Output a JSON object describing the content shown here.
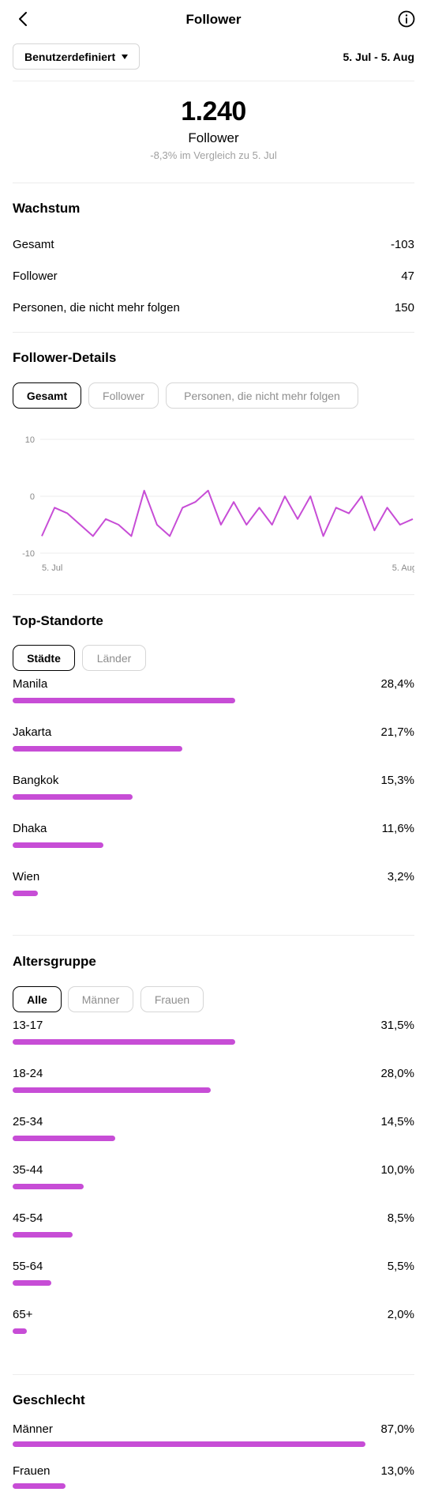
{
  "header": {
    "title": "Follower"
  },
  "range": {
    "dropdown_label": "Benutzerdefiniert",
    "date_range": "5. Jul - 5. Aug"
  },
  "summary": {
    "value": "1.240",
    "label": "Follower",
    "comparison": "-8,3% im Vergleich zu 5. Jul"
  },
  "growth": {
    "title": "Wachstum",
    "rows": [
      {
        "label": "Gesamt",
        "value": "-103"
      },
      {
        "label": "Follower",
        "value": "47"
      },
      {
        "label": "Personen, die nicht mehr folgen",
        "value": "150"
      }
    ]
  },
  "details": {
    "title": "Follower-Details",
    "tabs": [
      "Gesamt",
      "Follower",
      "Personen, die nicht mehr folgen"
    ],
    "active_tab": 0
  },
  "chart_data": {
    "type": "line",
    "ylim": [
      -10,
      10
    ],
    "y_ticks": [
      "10",
      "0",
      "-10"
    ],
    "x_start_label": "5. Jul",
    "x_end_label": "5. Aug",
    "line_color": "#c74dd6",
    "grid": true,
    "series": [
      {
        "values": [
          -7,
          -2,
          -3,
          -5,
          -7,
          -4,
          -5,
          -7,
          1,
          -5,
          -7,
          -2,
          -1,
          1,
          -5,
          -1,
          -5,
          -2,
          -5,
          0,
          -4,
          0,
          -7,
          -2,
          -3,
          0,
          -6,
          -2,
          -5,
          -4
        ]
      }
    ]
  },
  "locations": {
    "title": "Top-Standorte",
    "tabs": [
      "Städte",
      "Länder"
    ],
    "active_tab": 0,
    "items": [
      {
        "label": "Manila",
        "value": "28,4%",
        "pct": 28.4
      },
      {
        "label": "Jakarta",
        "value": "21,7%",
        "pct": 21.7
      },
      {
        "label": "Bangkok",
        "value": "15,3%",
        "pct": 15.3
      },
      {
        "label": "Dhaka",
        "value": "11,6%",
        "pct": 11.6
      },
      {
        "label": "Wien",
        "value": "3,2%",
        "pct": 3.2
      }
    ]
  },
  "age": {
    "title": "Altersgruppe",
    "tabs": [
      "Alle",
      "Männer",
      "Frauen"
    ],
    "active_tab": 0,
    "items": [
      {
        "label": "13-17",
        "value": "31,5%",
        "pct": 31.5
      },
      {
        "label": "18-24",
        "value": "28,0%",
        "pct": 28.0
      },
      {
        "label": "25-34",
        "value": "14,5%",
        "pct": 14.5
      },
      {
        "label": "35-44",
        "value": "10,0%",
        "pct": 10.0
      },
      {
        "label": "45-54",
        "value": "8,5%",
        "pct": 8.5
      },
      {
        "label": "55-64",
        "value": "5,5%",
        "pct": 5.5
      },
      {
        "label": "65+",
        "value": "2,0%",
        "pct": 2.0
      }
    ]
  },
  "gender": {
    "title": "Geschlecht",
    "items": [
      {
        "label": "Männer",
        "value": "87,0%",
        "pct": 87.0
      },
      {
        "label": "Frauen",
        "value": "13,0%",
        "pct": 13.0
      }
    ]
  },
  "colors": {
    "accent": "#c74dd6"
  }
}
